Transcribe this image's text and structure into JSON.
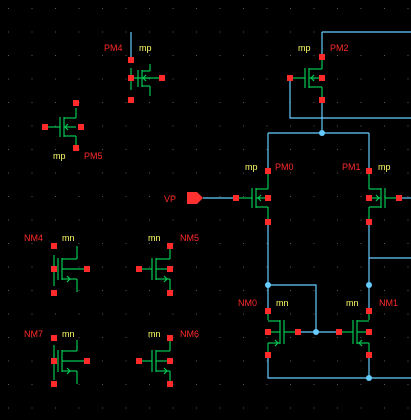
{
  "colors": {
    "background": "#000000",
    "grid_dot": "#5a5a5a",
    "wire": "#66ccff",
    "device": "#00c853",
    "pin": "#ff0000",
    "instance_label": "#ff2a2a",
    "model_label": "#ffff66",
    "pin_shape": "#ff3030"
  },
  "devices": {
    "PM4": {
      "name": "PM4",
      "model": "mp",
      "type": "pmos"
    },
    "PM2": {
      "name": "PM2",
      "model": "mp",
      "type": "pmos"
    },
    "PM5": {
      "name": "PM5",
      "model": "mp",
      "type": "pmos"
    },
    "PM0": {
      "name": "PM0",
      "model": "mp",
      "type": "pmos"
    },
    "PM1": {
      "name": "PM1",
      "model": "mp",
      "type": "pmos"
    },
    "NM4": {
      "name": "NM4",
      "model": "mn",
      "type": "nmos"
    },
    "NM5": {
      "name": "NM5",
      "model": "mn",
      "type": "nmos"
    },
    "NM0": {
      "name": "NM0",
      "model": "mn",
      "type": "nmos"
    },
    "NM1": {
      "name": "NM1",
      "model": "mn",
      "type": "nmos"
    },
    "NM7": {
      "name": "NM7",
      "model": "mn",
      "type": "nmos"
    },
    "NM6": {
      "name": "NM6",
      "model": "mn",
      "type": "nmos"
    }
  },
  "pins": {
    "vp": {
      "name": "VP",
      "direction": "input"
    }
  }
}
